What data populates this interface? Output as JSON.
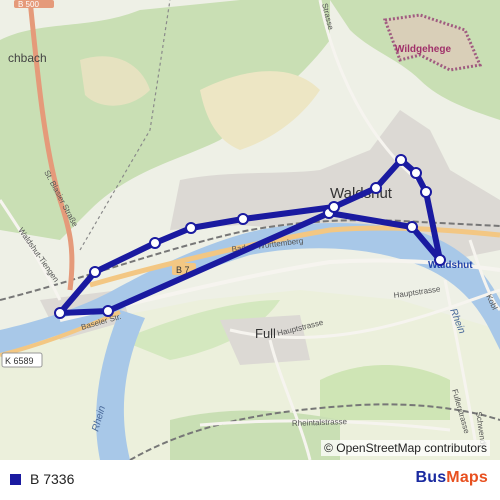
{
  "map": {
    "place_labels": {
      "waldshut_center": "Waldshut",
      "waldshut_stop": "Waldshut",
      "full": "Full",
      "wildgehege": "Wildgehege",
      "fragment_chbach": "chbach",
      "fragment_b500": "B 500"
    },
    "road_labels": {
      "sankt_blasier_strasse": "St. Blasier Straße",
      "tiengen_road": "Waldshut-Tiengen",
      "baseler_strasse": "Baseler Str.",
      "bahnhof_wuerttemberg": "Baden-Württemberg",
      "b_route": "B 7",
      "k6589": "K 6589",
      "hauptstrasse_full": "Hauptstrasse",
      "hauptstrasse_east": "Hauptstrasse",
      "rheintalstrasse": "Rheintalstrasse",
      "fullerstrasse": "Fullerstrasse",
      "schwendi": "Schwendi",
      "kobl": "Kobl",
      "strasse_north": "Strasse"
    },
    "water_labels": {
      "rhein_west": "Rhein",
      "rhein_east": "Rhein"
    },
    "route": {
      "color": "#1a1aa0",
      "stop_count": 14
    },
    "attribution": "© OpenStreetMap contributors"
  },
  "legend": {
    "route_name": "B 7336",
    "swatch_color": "#1a1aa0"
  },
  "brand": {
    "part1": "Bus",
    "part2": "Maps"
  }
}
